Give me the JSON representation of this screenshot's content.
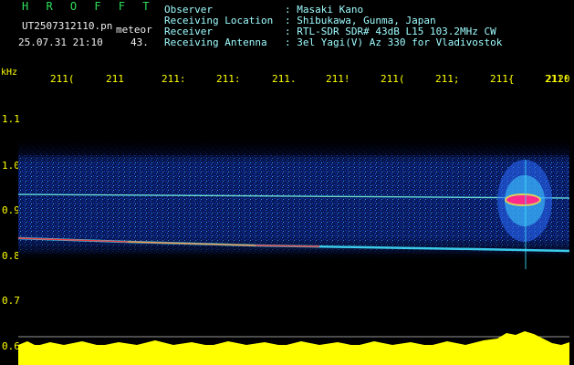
{
  "header": {
    "brand": "H R O F F T",
    "filename": "UT2507312110.pn",
    "type_label": "meteor",
    "datetime": "25.07.31 21:10",
    "count": "43.",
    "info": [
      {
        "label": "Observer",
        "value": ": Masaki Kano"
      },
      {
        "label": "Receiving Location",
        "value": ": Shibukawa, Gunma, Japan"
      },
      {
        "label": "Receiver",
        "value": ": RTL-SDR SDR# 43dB L15 103.2MHz CW"
      },
      {
        "label": "Receiving Antenna",
        "value": ": 3el Yagi(V) Az 330 for Vladivostok"
      }
    ]
  },
  "axes": {
    "unit": "kHz",
    "x_ticks": [
      "211(",
      "211",
      "211:",
      "211:",
      "211.",
      "211!",
      "211(",
      "211;",
      "211{",
      "211!",
      "2120"
    ],
    "y_ticks": [
      "1.1",
      "1.0",
      "0.9",
      "0.8",
      "0.7",
      "0.6"
    ]
  },
  "colors": {
    "background": "#000000",
    "text_cyan": "#9ffcff",
    "axis_yellow": "#ffff00",
    "brand_green": "#2ee05a",
    "signal_blue": "#1e3cff",
    "signal_red": "#ff2020",
    "signal_magenta": "#ff2a8a"
  }
}
